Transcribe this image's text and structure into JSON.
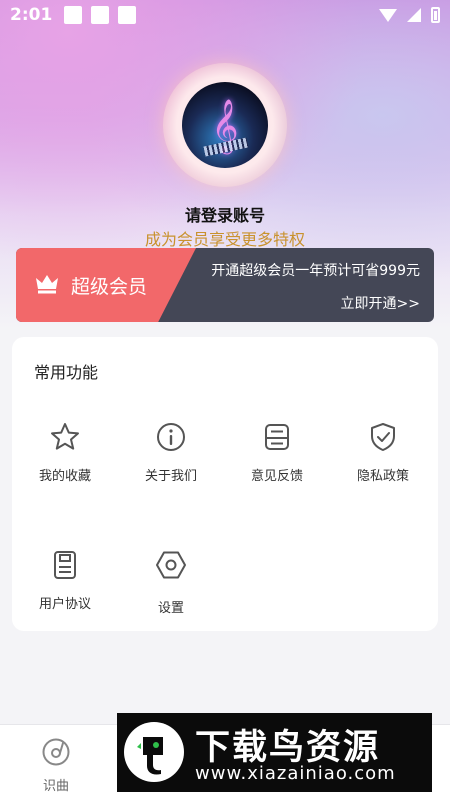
{
  "status_bar": {
    "time": "2:01"
  },
  "profile": {
    "login_prompt": "请登录账号",
    "member_benefit": "成为会员享受更多特权"
  },
  "vip_banner": {
    "title": "超级会员",
    "description": "开通超级会员一年预计可省999元",
    "action": "立即开通>>"
  },
  "features": {
    "title": "常用功能",
    "items": [
      {
        "label": "我的收藏",
        "icon": "star-icon"
      },
      {
        "label": "关于我们",
        "icon": "info-icon"
      },
      {
        "label": "意见反馈",
        "icon": "feedback-icon"
      },
      {
        "label": "隐私政策",
        "icon": "shield-check-icon"
      },
      {
        "label": "用户协议",
        "icon": "document-icon"
      },
      {
        "label": "设置",
        "icon": "settings-hexagon-icon"
      }
    ]
  },
  "bottom_nav": {
    "items": [
      {
        "label": "识曲",
        "icon": "music-disc-icon"
      }
    ]
  },
  "watermark": {
    "title": "下载鸟资源",
    "url": "www.xiazainiao.com"
  },
  "colors": {
    "vip_accent": "#f2686a",
    "vip_dark": "#444756",
    "benefit_gold": "#c9922e"
  }
}
